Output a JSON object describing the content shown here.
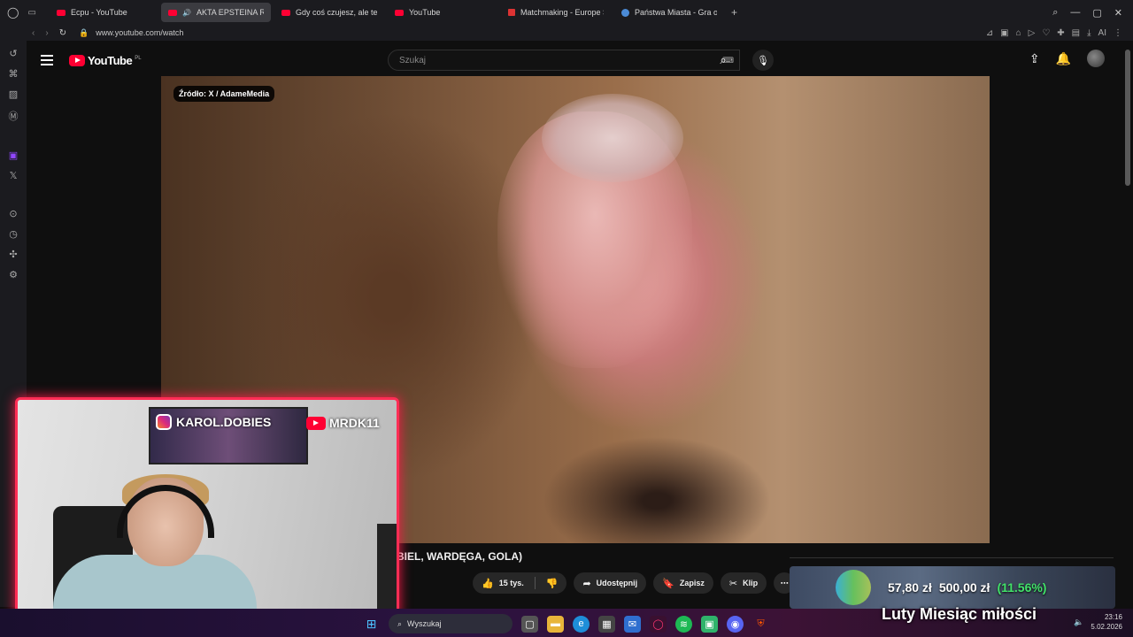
{
  "browser": {
    "tabs": [
      {
        "label": "Ecpu - YouTube",
        "fav": "youtube",
        "active": false
      },
      {
        "label": "AKTA EPSTEINA RO",
        "fav": "youtube",
        "active": true
      },
      {
        "label": "Gdy coś czujesz, ale tego",
        "fav": "youtube",
        "active": false
      },
      {
        "label": "YouTube",
        "fav": "youtube",
        "active": false
      },
      {
        "label": "Matchmaking - Europe Sv",
        "fav": "arrow",
        "active": false
      },
      {
        "label": "Państwa Miasta - Gra onli",
        "fav": "globe",
        "active": false
      }
    ],
    "new_tab": "+",
    "url": "www.youtube.com/watch",
    "ai_label": "AI"
  },
  "youtube": {
    "logo": "YouTube",
    "country": "PL",
    "search_placeholder": "Szukaj",
    "video": {
      "source_badge": "Źródło: X / AdameMedia",
      "title_fragment": "BIEL, WARDĘGA, GOLA)"
    },
    "actions": {
      "likes": "15 tys.",
      "share": "Udostępnij",
      "save": "Zapisz",
      "clip": "Klip",
      "more": "⋯"
    }
  },
  "overlay": {
    "instagram": "KAROL.DOBIES",
    "youtube_channel": "MRDK11",
    "donation": {
      "current": "57,80 zł",
      "goal": "500,00 zł",
      "percent": "(11.56%)"
    },
    "banner": "Luty Miesiąc miłości"
  },
  "taskbar": {
    "search": "Wyszukaj",
    "time": "23:16",
    "date": "5.02.2026"
  },
  "colors": {
    "accent_red": "#ff0033",
    "cam_border": "#ff2d55",
    "donation_pct": "#42e26a"
  }
}
